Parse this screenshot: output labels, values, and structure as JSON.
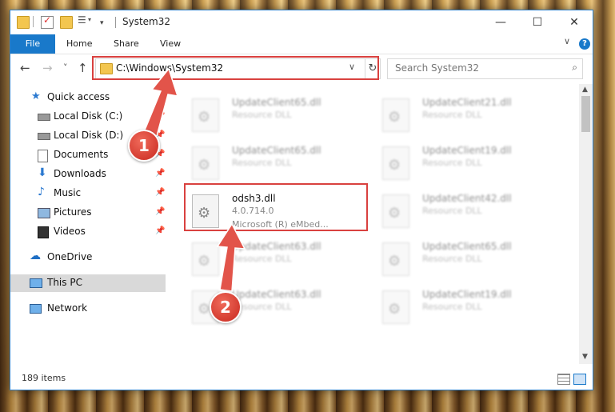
{
  "window": {
    "title": "System32",
    "controls": {
      "minimize": "—",
      "maximize": "☐",
      "close": "✕"
    }
  },
  "ribbon": {
    "tabs": [
      "File",
      "Home",
      "Share",
      "View"
    ],
    "help": "?",
    "collapse_chevron": "∨"
  },
  "navbar": {
    "back": "←",
    "forward": "→",
    "recent": "˅",
    "up": "↑",
    "address": "C:\\Windows\\System32",
    "address_chevron": "∨",
    "refresh": "↻",
    "search_placeholder": "Search System32",
    "search_icon": "⌕"
  },
  "sidebar": {
    "items": [
      {
        "label": "Quick access",
        "icon": "star-icon",
        "pinned": false
      },
      {
        "label": "Local Disk (C:)",
        "icon": "drive-icon",
        "pinned": true
      },
      {
        "label": "Local Disk (D:)",
        "icon": "drive-icon",
        "pinned": true
      },
      {
        "label": "Documents",
        "icon": "documents-icon",
        "pinned": true
      },
      {
        "label": "Downloads",
        "icon": "download-icon",
        "pinned": true
      },
      {
        "label": "Music",
        "icon": "music-icon",
        "pinned": true
      },
      {
        "label": "Pictures",
        "icon": "pictures-icon",
        "pinned": true
      },
      {
        "label": "Videos",
        "icon": "videos-icon",
        "pinned": true
      },
      {
        "label": "OneDrive",
        "icon": "cloud-icon",
        "pinned": false
      },
      {
        "label": "This PC",
        "icon": "computer-icon",
        "pinned": false,
        "selected": true
      },
      {
        "label": "Network",
        "icon": "network-icon",
        "pinned": false
      }
    ],
    "pin_glyph": "📌"
  },
  "files": {
    "left_col": [
      {
        "name": "UpdateClient65.dll",
        "type": "Resource DLL"
      },
      {
        "name": "UpdateClient65.dll",
        "type": "Resource DLL"
      },
      {
        "name": "odsh3.dll",
        "version": "4.0.714.0",
        "company": "Microsoft (R) eMbed..."
      },
      {
        "name": "UpdateClient63.dll",
        "type": "Resource DLL"
      },
      {
        "name": "UpdateClient63.dll",
        "type": "Resource DLL"
      }
    ],
    "right_col": [
      {
        "name": "UpdateClient21.dll",
        "type": "Resource DLL"
      },
      {
        "name": "UpdateClient19.dll",
        "type": "Resource DLL"
      },
      {
        "name": "UpdateClient42.dll",
        "type": "Resource DLL"
      },
      {
        "name": "UpdateClient65.dll",
        "type": "Resource DLL"
      },
      {
        "name": "UpdateClient19.dll",
        "type": "Resource DLL"
      }
    ]
  },
  "status": {
    "item_count": "189 items"
  },
  "annotations": {
    "step1": "1",
    "step2": "2"
  },
  "colors": {
    "accent": "#1979ca",
    "highlight": "#d9413f",
    "selected": "#d9d9d9"
  }
}
